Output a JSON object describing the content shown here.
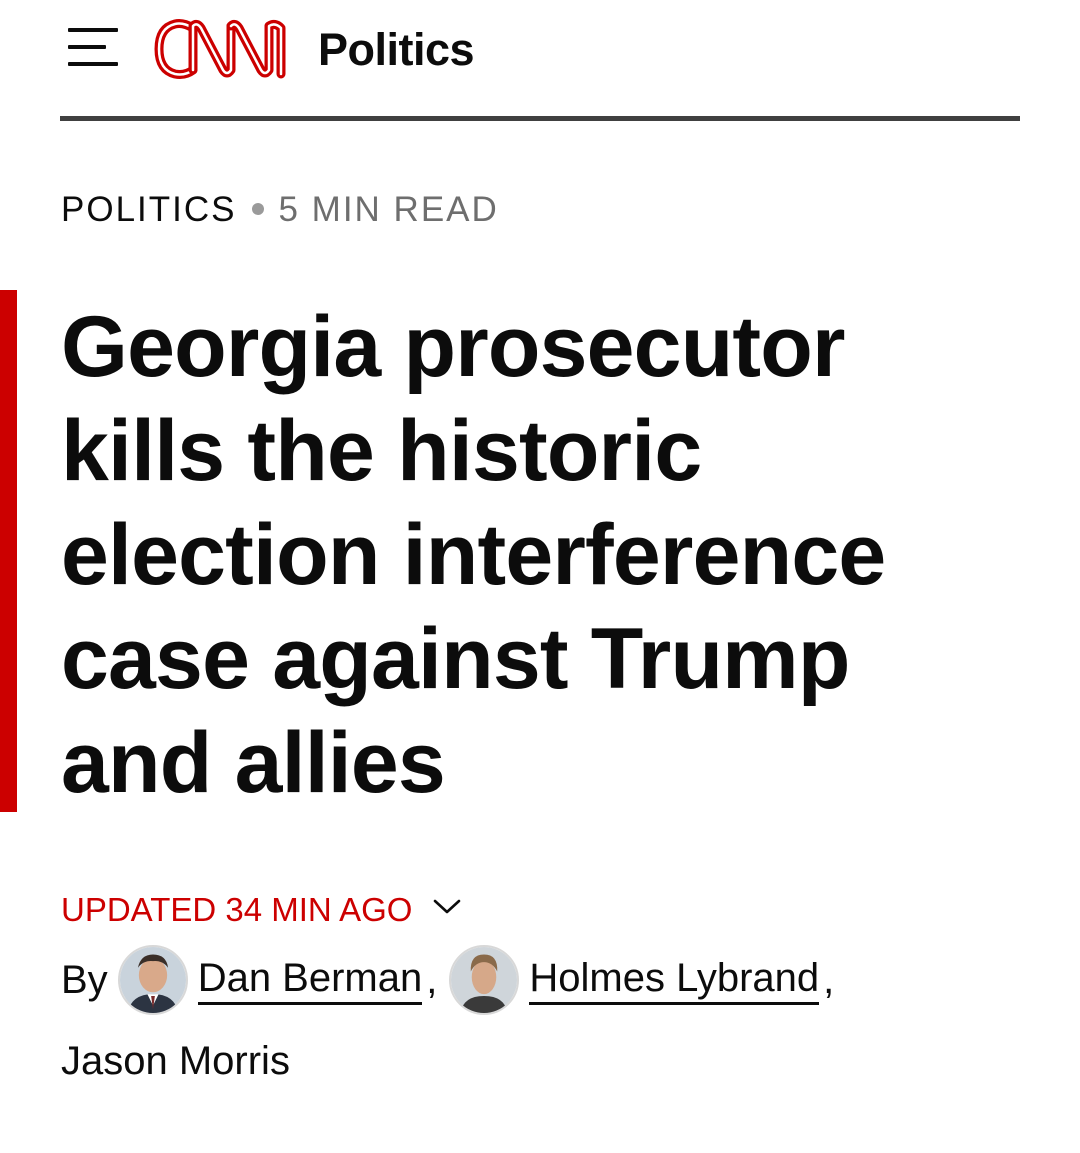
{
  "header": {
    "menu_icon": "hamburger-menu-icon",
    "logo_text": "CNN",
    "section": "Politics",
    "brand_color": "#cc0000"
  },
  "eyebrow": {
    "category": "POLITICS",
    "read_time": "5 MIN READ"
  },
  "headline": "Georgia prosecutor kills the historic election interference case against Trump and allies",
  "updated": {
    "text": "UPDATED 34 MIN AGO",
    "icon": "chevron-down-icon"
  },
  "byline": {
    "by_label": "By",
    "authors": [
      {
        "name": "Dan Berman",
        "has_avatar": true,
        "linked": true
      },
      {
        "name": "Holmes Lybrand",
        "has_avatar": true,
        "linked": true
      },
      {
        "name": "Jason Morris",
        "has_avatar": false,
        "linked": false
      }
    ],
    "separator": ","
  }
}
